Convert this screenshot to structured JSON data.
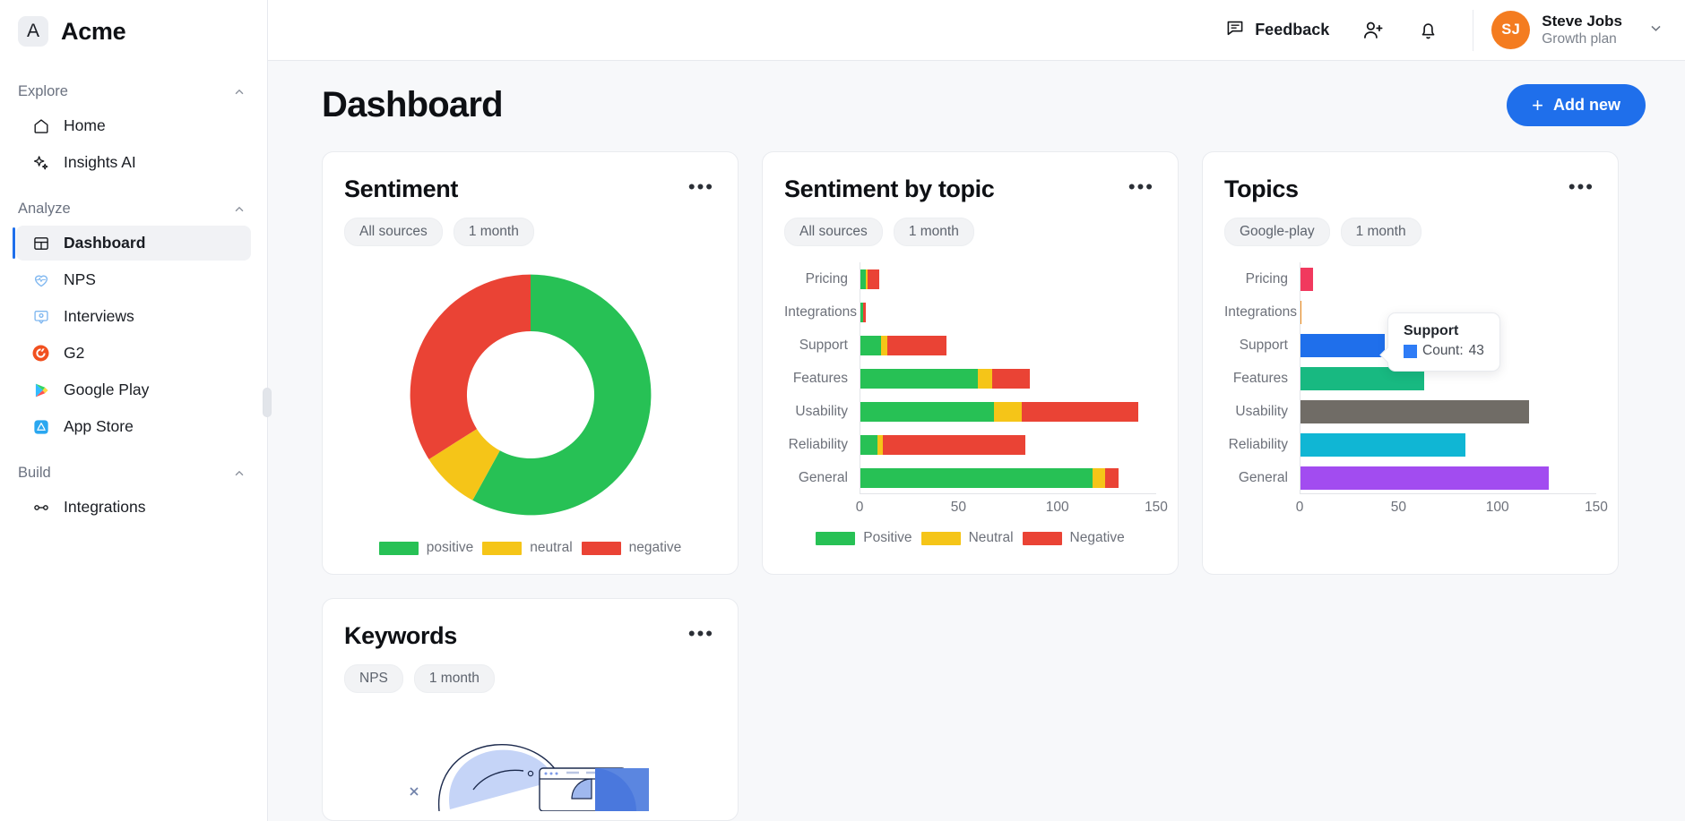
{
  "brand": {
    "initial": "A",
    "name": "Acme"
  },
  "sidebar": {
    "groups": [
      {
        "title": "Explore",
        "items": [
          {
            "label": "Home",
            "icon": "home-icon"
          },
          {
            "label": "Insights AI",
            "icon": "sparkle-icon"
          }
        ]
      },
      {
        "title": "Analyze",
        "items": [
          {
            "label": "Dashboard",
            "icon": "layout-icon"
          },
          {
            "label": "NPS",
            "icon": "heart-pulse-icon"
          },
          {
            "label": "Interviews",
            "icon": "interview-icon"
          },
          {
            "label": "G2",
            "icon": "g2-icon"
          },
          {
            "label": "Google Play",
            "icon": "google-play-icon"
          },
          {
            "label": "App Store",
            "icon": "app-store-icon"
          }
        ]
      },
      {
        "title": "Build",
        "items": [
          {
            "label": "Integrations",
            "icon": "integrations-icon"
          }
        ]
      }
    ]
  },
  "topbar": {
    "feedback_label": "Feedback",
    "invite_icon": "user-plus-icon",
    "notifications_icon": "bell-icon",
    "user": {
      "initials": "SJ",
      "name": "Steve Jobs",
      "plan": "Growth plan"
    }
  },
  "page": {
    "title": "Dashboard",
    "add_new_label": "Add new",
    "add_new_plus": "+"
  },
  "colors": {
    "accent": "#1f6feb",
    "positive": "#27c155",
    "neutral": "#f5c518",
    "negative": "#ea4335",
    "avatar": "#f47c20"
  },
  "cards": {
    "sentiment": {
      "title": "Sentiment",
      "menu_icon": "more-horizontal-icon",
      "chips": [
        "All sources",
        "1 month"
      ]
    },
    "sentiment_by_topic": {
      "title": "Sentiment by topic",
      "menu_icon": "more-horizontal-icon",
      "chips": [
        "All sources",
        "1 month"
      ]
    },
    "topics": {
      "title": "Topics",
      "menu_icon": "more-horizontal-icon",
      "chips": [
        "Google-play",
        "1 month"
      ],
      "tooltip": {
        "title": "Support",
        "label": "Count:",
        "value": "43"
      }
    },
    "keywords": {
      "title": "Keywords",
      "menu_icon": "more-horizontal-icon",
      "chips": [
        "NPS",
        "1 month"
      ]
    }
  },
  "chart_data": [
    {
      "id": "sentiment-donut",
      "type": "pie",
      "title": "Sentiment",
      "donut": true,
      "categories": [
        "positive",
        "neutral",
        "negative"
      ],
      "values": [
        58,
        8,
        34
      ],
      "colors": [
        "#27c155",
        "#f5c518",
        "#ea4335"
      ],
      "legend": "bottom",
      "labels": [
        "positive",
        "neutral",
        "negative"
      ]
    },
    {
      "id": "sentiment-by-topic",
      "type": "bar",
      "orientation": "horizontal",
      "stacked": true,
      "title": "Sentiment by topic",
      "categories": [
        "Pricing",
        "Integrations",
        "Support",
        "Features",
        "Usability",
        "Reliability",
        "General"
      ],
      "series": [
        {
          "name": "Positive",
          "color": "#27c155",
          "values": [
            3,
            2,
            11,
            60,
            68,
            9,
            118
          ]
        },
        {
          "name": "Neutral",
          "color": "#f5c518",
          "values": [
            1,
            0,
            3,
            7,
            14,
            3,
            6
          ]
        },
        {
          "name": "Negative",
          "color": "#ea4335",
          "values": [
            6,
            1,
            30,
            19,
            59,
            72,
            7
          ]
        }
      ],
      "xlabel": "",
      "ylabel": "",
      "xlim": [
        0,
        150
      ],
      "xticks": [
        0,
        50,
        100,
        150
      ],
      "grid": false,
      "legend": "bottom",
      "legend_entries": [
        "Positive",
        "Neutral",
        "Negative"
      ]
    },
    {
      "id": "topics",
      "type": "bar",
      "orientation": "horizontal",
      "stacked": false,
      "title": "Topics",
      "categories": [
        "Pricing",
        "Integrations",
        "Support",
        "Features",
        "Usability",
        "Reliability",
        "General"
      ],
      "values": [
        7,
        1,
        43,
        63,
        116,
        84,
        126
      ],
      "colors": [
        "#f1395e",
        "#f08c1a",
        "#1f6feb",
        "#18b981",
        "#706c66",
        "#10b6d4",
        "#a24cf0"
      ],
      "xlabel": "",
      "ylabel": "",
      "xlim": [
        0,
        150
      ],
      "xticks": [
        0,
        50,
        100,
        150
      ],
      "grid": false,
      "legend": "none",
      "annotations": [
        {
          "category": "Support",
          "text": "Count: 43"
        }
      ]
    }
  ]
}
